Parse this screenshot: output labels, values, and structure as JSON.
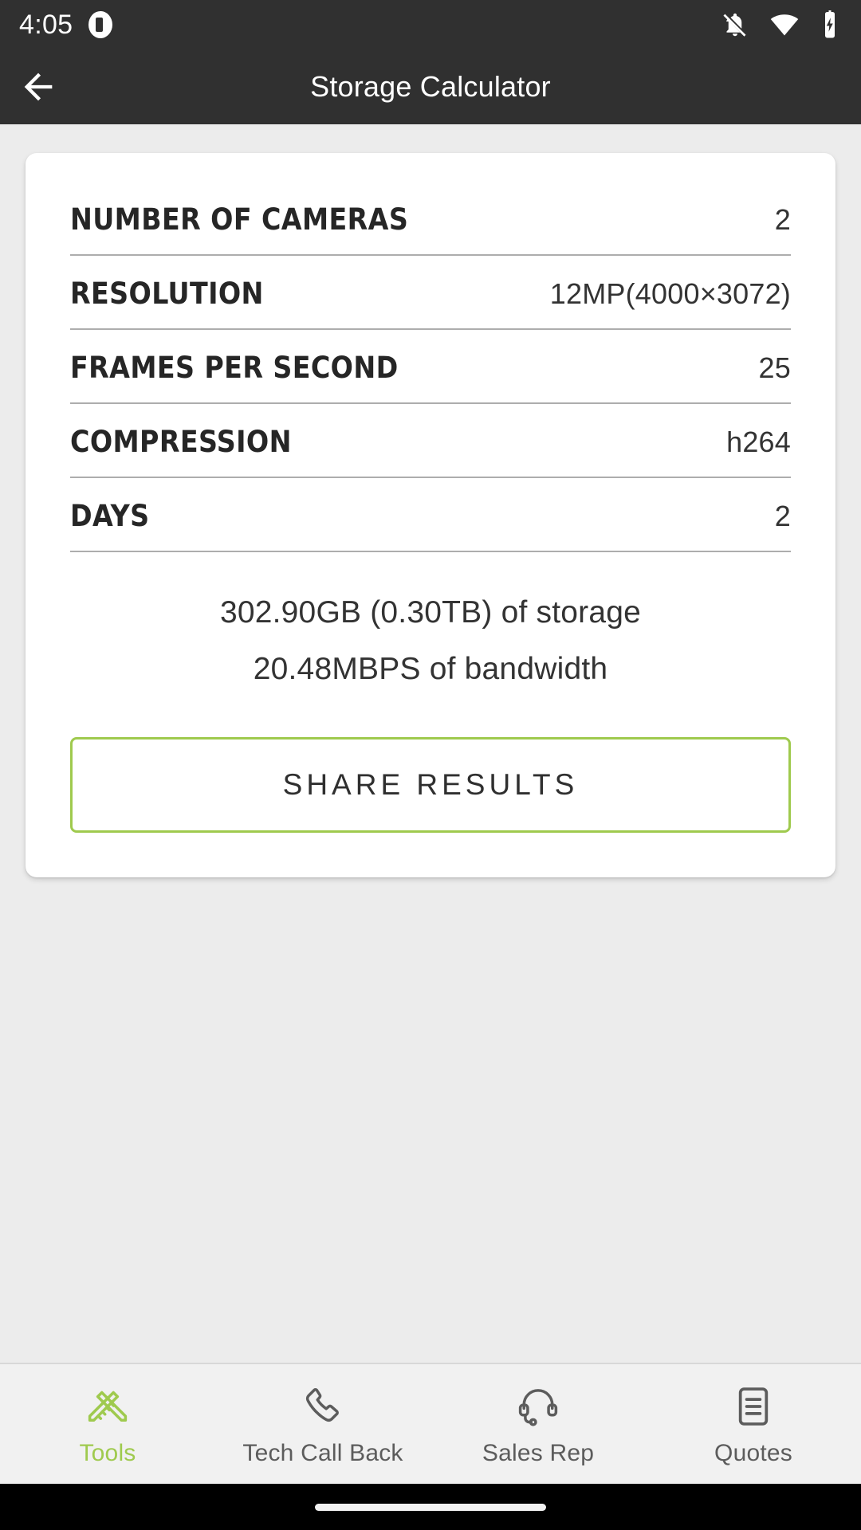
{
  "status_bar": {
    "time": "4:05",
    "icons": [
      "notifications-off-icon",
      "wifi-icon",
      "battery-charging-icon"
    ]
  },
  "app_bar": {
    "back_icon": "arrow-left-icon",
    "title": "Storage Calculator"
  },
  "calculator": {
    "rows": [
      {
        "label": "NUMBER OF CAMERAS",
        "value": "2"
      },
      {
        "label": "RESOLUTION",
        "value": "12MP(4000×3072)"
      },
      {
        "label": "FRAMES PER SECOND",
        "value": "25"
      },
      {
        "label": "COMPRESSION",
        "value": "h264"
      },
      {
        "label": "DAYS",
        "value": "2"
      }
    ],
    "results": [
      "302.90GB (0.30TB) of storage",
      "20.48MBPS of bandwidth"
    ],
    "share_button": "SHARE RESULTS"
  },
  "bottom_nav": {
    "items": [
      {
        "label": "Tools",
        "icon": "tools-icon",
        "active": true
      },
      {
        "label": "Tech Call Back",
        "icon": "phone-icon",
        "active": false
      },
      {
        "label": "Sales Rep",
        "icon": "headset-icon",
        "active": false
      },
      {
        "label": "Quotes",
        "icon": "document-icon",
        "active": false
      }
    ]
  },
  "colors": {
    "accent_green": "#9fca4e",
    "app_bar": "#303030",
    "page_background": "#ececec",
    "card": "#ffffff",
    "nav_background": "#f1f1f1",
    "text_primary": "#262626",
    "text_secondary": "#5c5c5c"
  }
}
